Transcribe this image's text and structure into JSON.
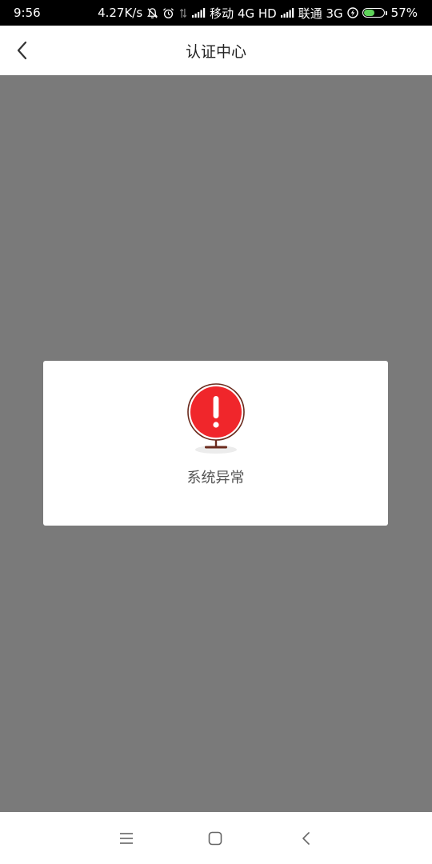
{
  "status_bar": {
    "time": "9:56",
    "network_speed": "4.27K/s",
    "carrier1": "移动 4G HD",
    "carrier2": "联通 3G",
    "battery_percent": "57%",
    "battery_level": 0.57,
    "icons": [
      "mute-bell-icon",
      "alarm-icon",
      "data-arrows-icon",
      "signal-icon",
      "signal-icon",
      "charging-icon",
      "battery-icon"
    ]
  },
  "header": {
    "title": "认证中心",
    "back_icon": "chevron-left-icon"
  },
  "dialog": {
    "icon": "exclamation-sign-icon",
    "message": "系统异常",
    "icon_color": "#f0262b"
  },
  "nav_bar": {
    "icons": [
      "menu-icon",
      "home-square-icon",
      "back-chevron-icon"
    ]
  },
  "colors": {
    "overlay": "#7a7a7a",
    "status_bar": "#000000",
    "surface": "#ffffff",
    "battery_fill": "#5fd35a"
  }
}
